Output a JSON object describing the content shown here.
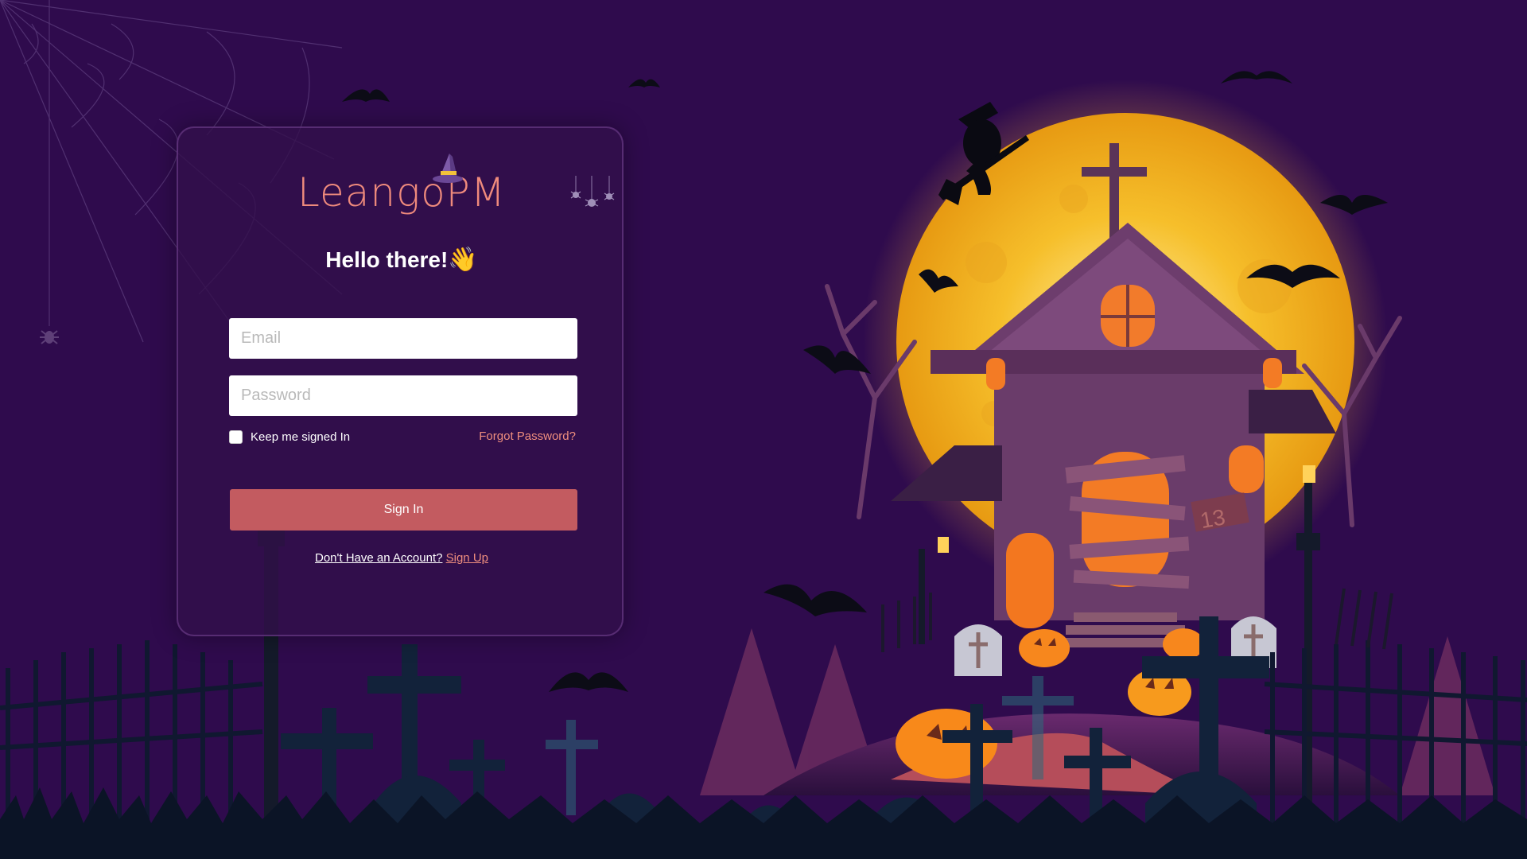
{
  "brand": {
    "logo_text": "LeangoPM"
  },
  "login": {
    "greeting": "Hello there!",
    "greeting_emoji": "👋",
    "email_placeholder": "Email",
    "password_placeholder": "Password",
    "remember_label": "Keep me signed In",
    "forgot_label": "Forgot Password?",
    "signin_label": "Sign In",
    "no_account_text": "Don't Have an Account?",
    "signup_label": "Sign Up"
  },
  "theme": {
    "background": "#2f0b4d",
    "moon": "#f7c52b",
    "accent_text": "#ef8e7e",
    "button": "#c35b60"
  }
}
